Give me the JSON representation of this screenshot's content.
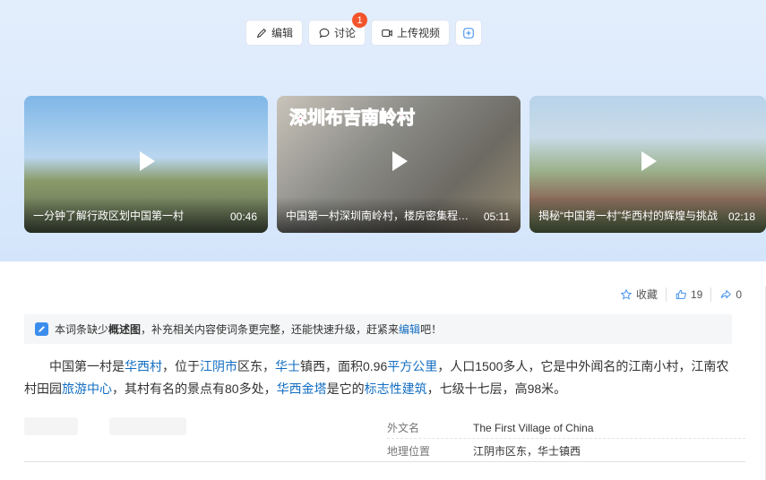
{
  "toolbar": {
    "edit_label": "编辑",
    "discuss_label": "讨论",
    "discuss_badge": "1",
    "upload_label": "上传视频"
  },
  "videos": [
    {
      "title": "一分钟了解行政区划中国第一村",
      "duration": "00:46"
    },
    {
      "title": "中国第一村深圳南岭村，楼房密集程…",
      "duration": "05:11",
      "overlay_text": "深圳布吉南岭村"
    },
    {
      "title": "揭秘“中国第一村”华西村的辉煌与挑战",
      "duration": "02:18"
    }
  ],
  "actions": {
    "favorite_label": "收藏",
    "like_count": "19",
    "share_count": "0"
  },
  "notice": {
    "prefix": "本词条缺少",
    "bold": "概述图",
    "middle": "，补充相关内容使词条更完整，还能快速升级，赶紧来",
    "link": "编辑",
    "suffix": "吧！"
  },
  "summary": {
    "p1": "中国第一村是",
    "l1": "华西村",
    "p2": "，位于",
    "l2": "江阴市",
    "p3": "区东，",
    "l3": "华士",
    "p4": "镇西，面积0.96",
    "l4": "平方公里",
    "p5": "，人口1500多人，它是中外闻名的江南小村，江南农村田园",
    "l5": "旅游中心",
    "p6": "，其村有名的景点有80多处，",
    "l6": "华西金塔",
    "p7": "是它的",
    "l7": "标志性建筑",
    "p8": "，七级十七层，高98米。"
  },
  "infobox": [
    {
      "label": "外文名",
      "value": "The First Village of China"
    },
    {
      "label": "地理位置",
      "value": "江阴市区东，华士镇西"
    }
  ],
  "colors": {
    "link": "#136ec2",
    "badge": "#f2552c",
    "accent": "#3b8ded"
  }
}
